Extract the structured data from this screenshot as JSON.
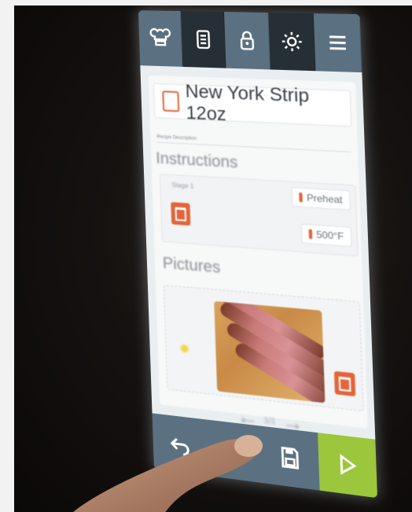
{
  "app": {
    "top_tabs": [
      {
        "icon": "chef-hat-icon"
      },
      {
        "icon": "recipe-card-icon"
      },
      {
        "icon": "lock-icon"
      },
      {
        "icon": "sun-icon"
      },
      {
        "icon": "hamburger-menu-icon"
      }
    ],
    "recipe_title": "New York Strip 12oz",
    "description_placeholder": "Recipe Description",
    "sections": {
      "instructions": "Instructions",
      "pictures": "Pictures"
    },
    "stage": {
      "label": "Stage 1",
      "mode": "Preheat",
      "temperature": "500°F"
    },
    "pager": {
      "text": "1/1"
    },
    "bottom_buttons": [
      {
        "icon": "back-icon"
      },
      {
        "icon": "plus-icon",
        "label": "+"
      },
      {
        "icon": "save-icon"
      },
      {
        "icon": "play-icon"
      }
    ]
  },
  "colors": {
    "bar": "#5b7181",
    "accent_orange": "#e5643a",
    "go_green": "#9cc63b"
  }
}
